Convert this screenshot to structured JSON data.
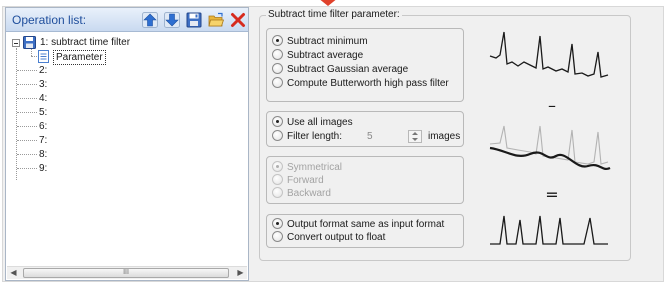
{
  "operation_list": {
    "title": "Operation list:",
    "toolbar_icons": [
      "arrow-up-icon",
      "arrow-down-icon",
      "save-icon",
      "folder-open-icon",
      "delete-icon"
    ],
    "items": [
      {
        "label": "1: subtract time filter",
        "expanded": true,
        "children": [
          {
            "label": "Parameter",
            "selected": true
          }
        ]
      },
      {
        "label": "2:"
      },
      {
        "label": "3:"
      },
      {
        "label": "4:"
      },
      {
        "label": "5:"
      },
      {
        "label": "6:"
      },
      {
        "label": "7:"
      },
      {
        "label": "8:"
      },
      {
        "label": "9:"
      }
    ],
    "scrollbar_thumb_glyph": "III"
  },
  "params": {
    "title": "Subtract time filter parameter:",
    "method_options": [
      {
        "label": "Subtract minimum",
        "checked": true
      },
      {
        "label": "Subtract average",
        "checked": false
      },
      {
        "label": "Subtract Gaussian average",
        "checked": false
      },
      {
        "label": "Compute Butterworth high pass filter",
        "checked": false
      }
    ],
    "range_options": [
      {
        "label": "Use all images",
        "checked": true
      },
      {
        "label": "Filter length:",
        "checked": false
      }
    ],
    "filter_length_value": "5",
    "filter_length_unit": "images",
    "window_options": [
      {
        "label": "Symmetrical",
        "checked": true
      },
      {
        "label": "Forward",
        "checked": false
      },
      {
        "label": "Backward",
        "checked": false
      }
    ],
    "output_options": [
      {
        "label": "Output format same as input format",
        "checked": true
      },
      {
        "label": "Convert output to float",
        "checked": false
      }
    ]
  },
  "illustration": {
    "operators": [
      "–",
      "="
    ],
    "signal_color": "#1a1a1a",
    "faded_signal_color": "#b3b3b3"
  },
  "colors": {
    "header_text": "#1f4e9c",
    "marker": "#e0412b"
  }
}
